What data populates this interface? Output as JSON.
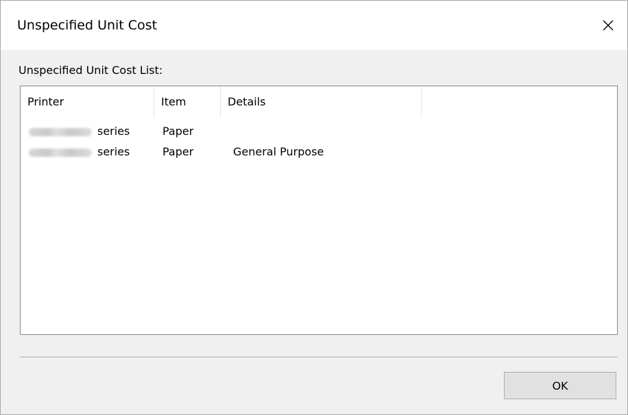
{
  "window": {
    "title": "Unspecified Unit Cost",
    "close_icon": "close-icon"
  },
  "list": {
    "label": "Unspecified Unit Cost List:",
    "columns": [
      "Printer",
      "Item",
      "Details"
    ],
    "rows": [
      {
        "printer_model": "(obscured model name)",
        "printer_suffix": "series",
        "item": "Paper",
        "details": ""
      },
      {
        "printer_model": "(obscured model name)",
        "printer_suffix": "series",
        "item": "Paper",
        "details": "General Purpose"
      }
    ]
  },
  "buttons": {
    "ok_label": "OK"
  }
}
